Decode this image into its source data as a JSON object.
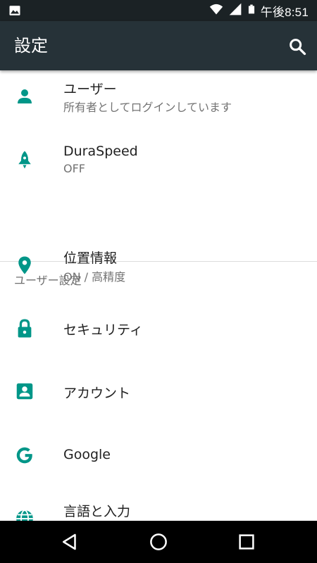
{
  "status_bar": {
    "time": "午後8:51",
    "icons": [
      "gallery-icon",
      "wifi-icon",
      "signal-icon",
      "battery-icon"
    ]
  },
  "app_bar": {
    "title": "設定",
    "search_icon": "search-icon"
  },
  "colors": {
    "status_bar": "#1b2225",
    "app_bar": "#263238",
    "accent": "#009688",
    "title_text": "#212121",
    "secondary_text": "#737373"
  },
  "settings": {
    "user": {
      "title": "ユーザー",
      "summary": "所有者としてログインしています",
      "icon": "person-icon"
    },
    "duraspeed": {
      "title": "DuraSpeed",
      "summary": "OFF",
      "icon": "rocket-icon"
    },
    "section_header": "ユーザー設定",
    "location": {
      "title": "位置情報",
      "summary": "ON / 高精度",
      "icon": "location-pin-icon"
    },
    "security": {
      "title": "セキュリティ",
      "icon": "lock-icon"
    },
    "accounts": {
      "title": "アカウント",
      "icon": "account-box-icon"
    },
    "google": {
      "title": "Google",
      "icon": "google-icon"
    },
    "language": {
      "title": "言語と入力",
      "icon": "globe-icon"
    }
  },
  "nav_bar": {
    "back": "back-icon",
    "home": "home-icon",
    "recents": "recents-icon"
  }
}
